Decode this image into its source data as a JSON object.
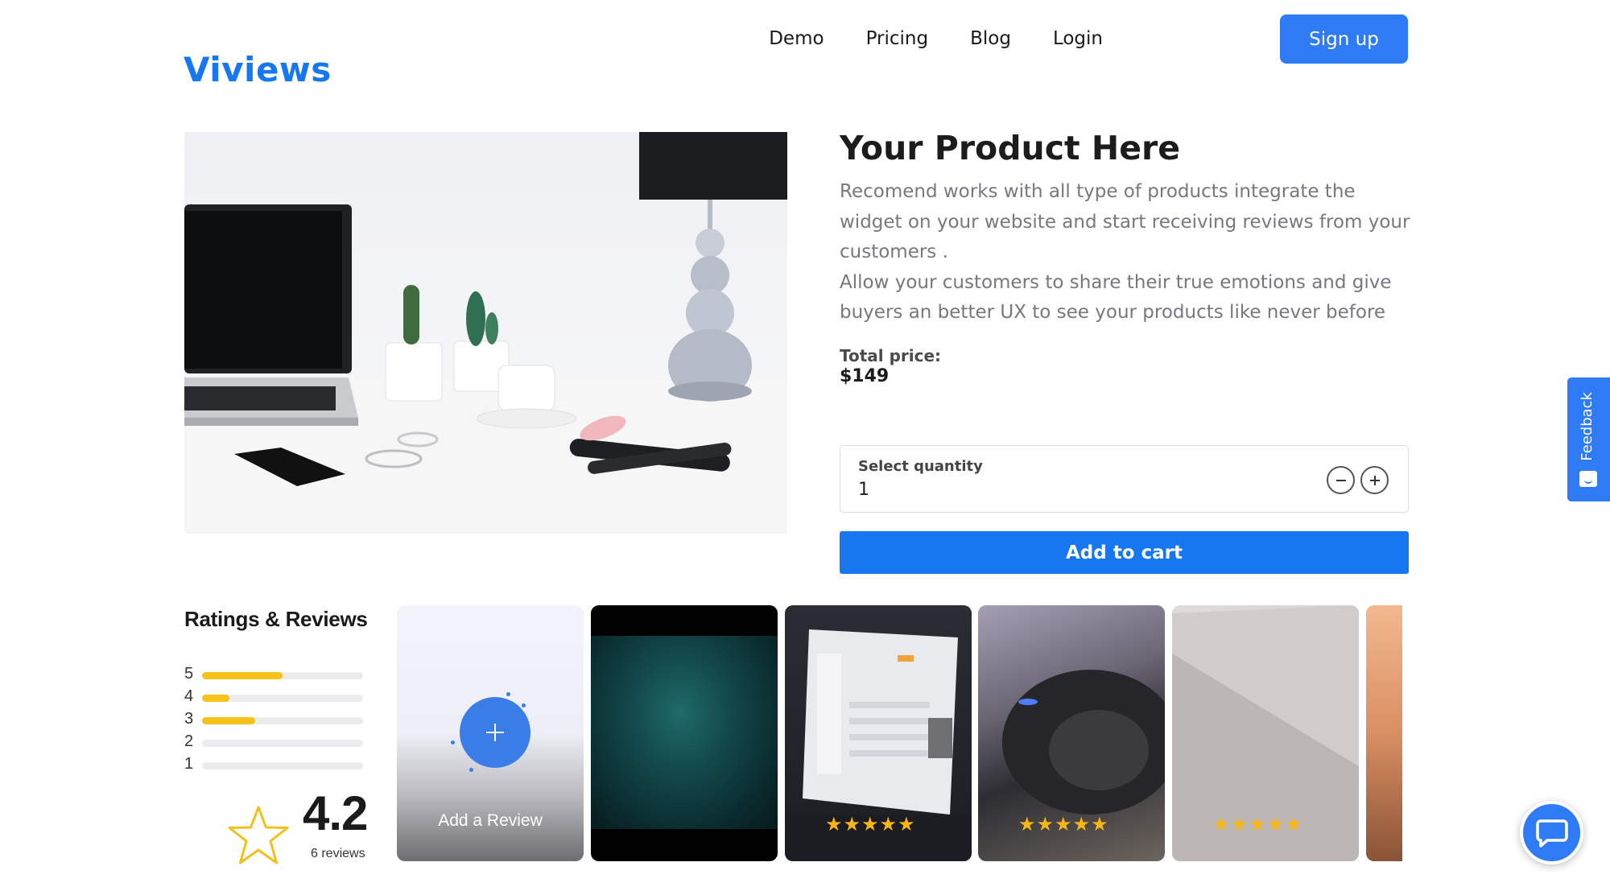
{
  "header": {
    "logo": "Viviews",
    "nav": [
      "Demo",
      "Pricing",
      "Blog",
      "Login"
    ],
    "signup_label": "Sign up"
  },
  "product": {
    "title": "Your Product Here",
    "description_1": "Recomend works with all type of products integrate the widget on your website and start receiving reviews from your customers .",
    "description_2": "Allow your customers to share their true emotions and give buyers an better UX to see your products like never before",
    "price_label": "Total price:",
    "price": "$149",
    "quantity_label": "Select quantity",
    "quantity_value": "1",
    "add_to_cart_label": "Add to cart"
  },
  "feedback": {
    "label": "Feedback"
  },
  "ratings": {
    "title": "Ratings & Reviews",
    "rows": [
      {
        "stars": "5",
        "fraction": 0.5
      },
      {
        "stars": "4",
        "fraction": 0.17
      },
      {
        "stars": "3",
        "fraction": 0.33
      },
      {
        "stars": "2",
        "fraction": 0.0
      },
      {
        "stars": "1",
        "fraction": 0.0
      }
    ],
    "average": "4.2",
    "count_label": "6 reviews"
  },
  "reviews": {
    "add_label": "Add a Review",
    "card_ratings": [
      5,
      5,
      5
    ]
  },
  "colors": {
    "brand": "#1677f0",
    "star": "#f7c31b"
  },
  "icons": {
    "quantity_minus": "minus-icon",
    "quantity_plus": "plus-icon",
    "chat": "chat-bubble-icon",
    "feedback": "smile-icon"
  }
}
